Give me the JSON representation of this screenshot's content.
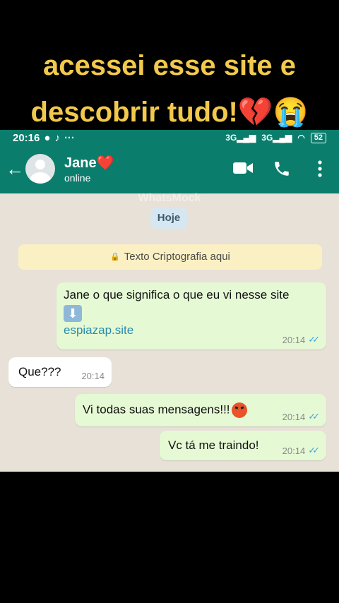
{
  "caption": {
    "line1": "acessei esse site e",
    "line2": "descobrir tudo!💔😭"
  },
  "statusbar": {
    "time": "20:16",
    "signal1": "3G",
    "signal2": "3G",
    "battery": "52"
  },
  "header": {
    "contact_name": "Jane❤️",
    "contact_status": "online",
    "watermark": "WhatsMock",
    "back_icon": "arrow-left-icon",
    "video_icon": "video-call-icon",
    "call_icon": "phone-icon",
    "menu_icon": "more-vert-icon"
  },
  "chat": {
    "day_label": "Hoje",
    "encryption_notice": "Texto Criptografia aqui",
    "messages": [
      {
        "direction": "out",
        "text": "Jane o que significa o que eu vi nesse site",
        "emoji": "⬇",
        "link": "espiazap.site",
        "time": "20:14",
        "status": "read"
      },
      {
        "direction": "in",
        "text": "Que???",
        "time": "20:14"
      },
      {
        "direction": "out",
        "text": "Vi todas suas mensagens!!!",
        "time": "20:14",
        "status": "read"
      },
      {
        "direction": "out",
        "text": "Vc tá me traindo!",
        "time": "20:14",
        "status": "read"
      }
    ]
  },
  "colors": {
    "header": "#0a7d6c",
    "caption": "#f2c94c",
    "chat_bg": "#e8e1d7",
    "outgoing": "#e5f9d4",
    "incoming": "#ffffff",
    "read_ticks": "#3aa7e0"
  }
}
